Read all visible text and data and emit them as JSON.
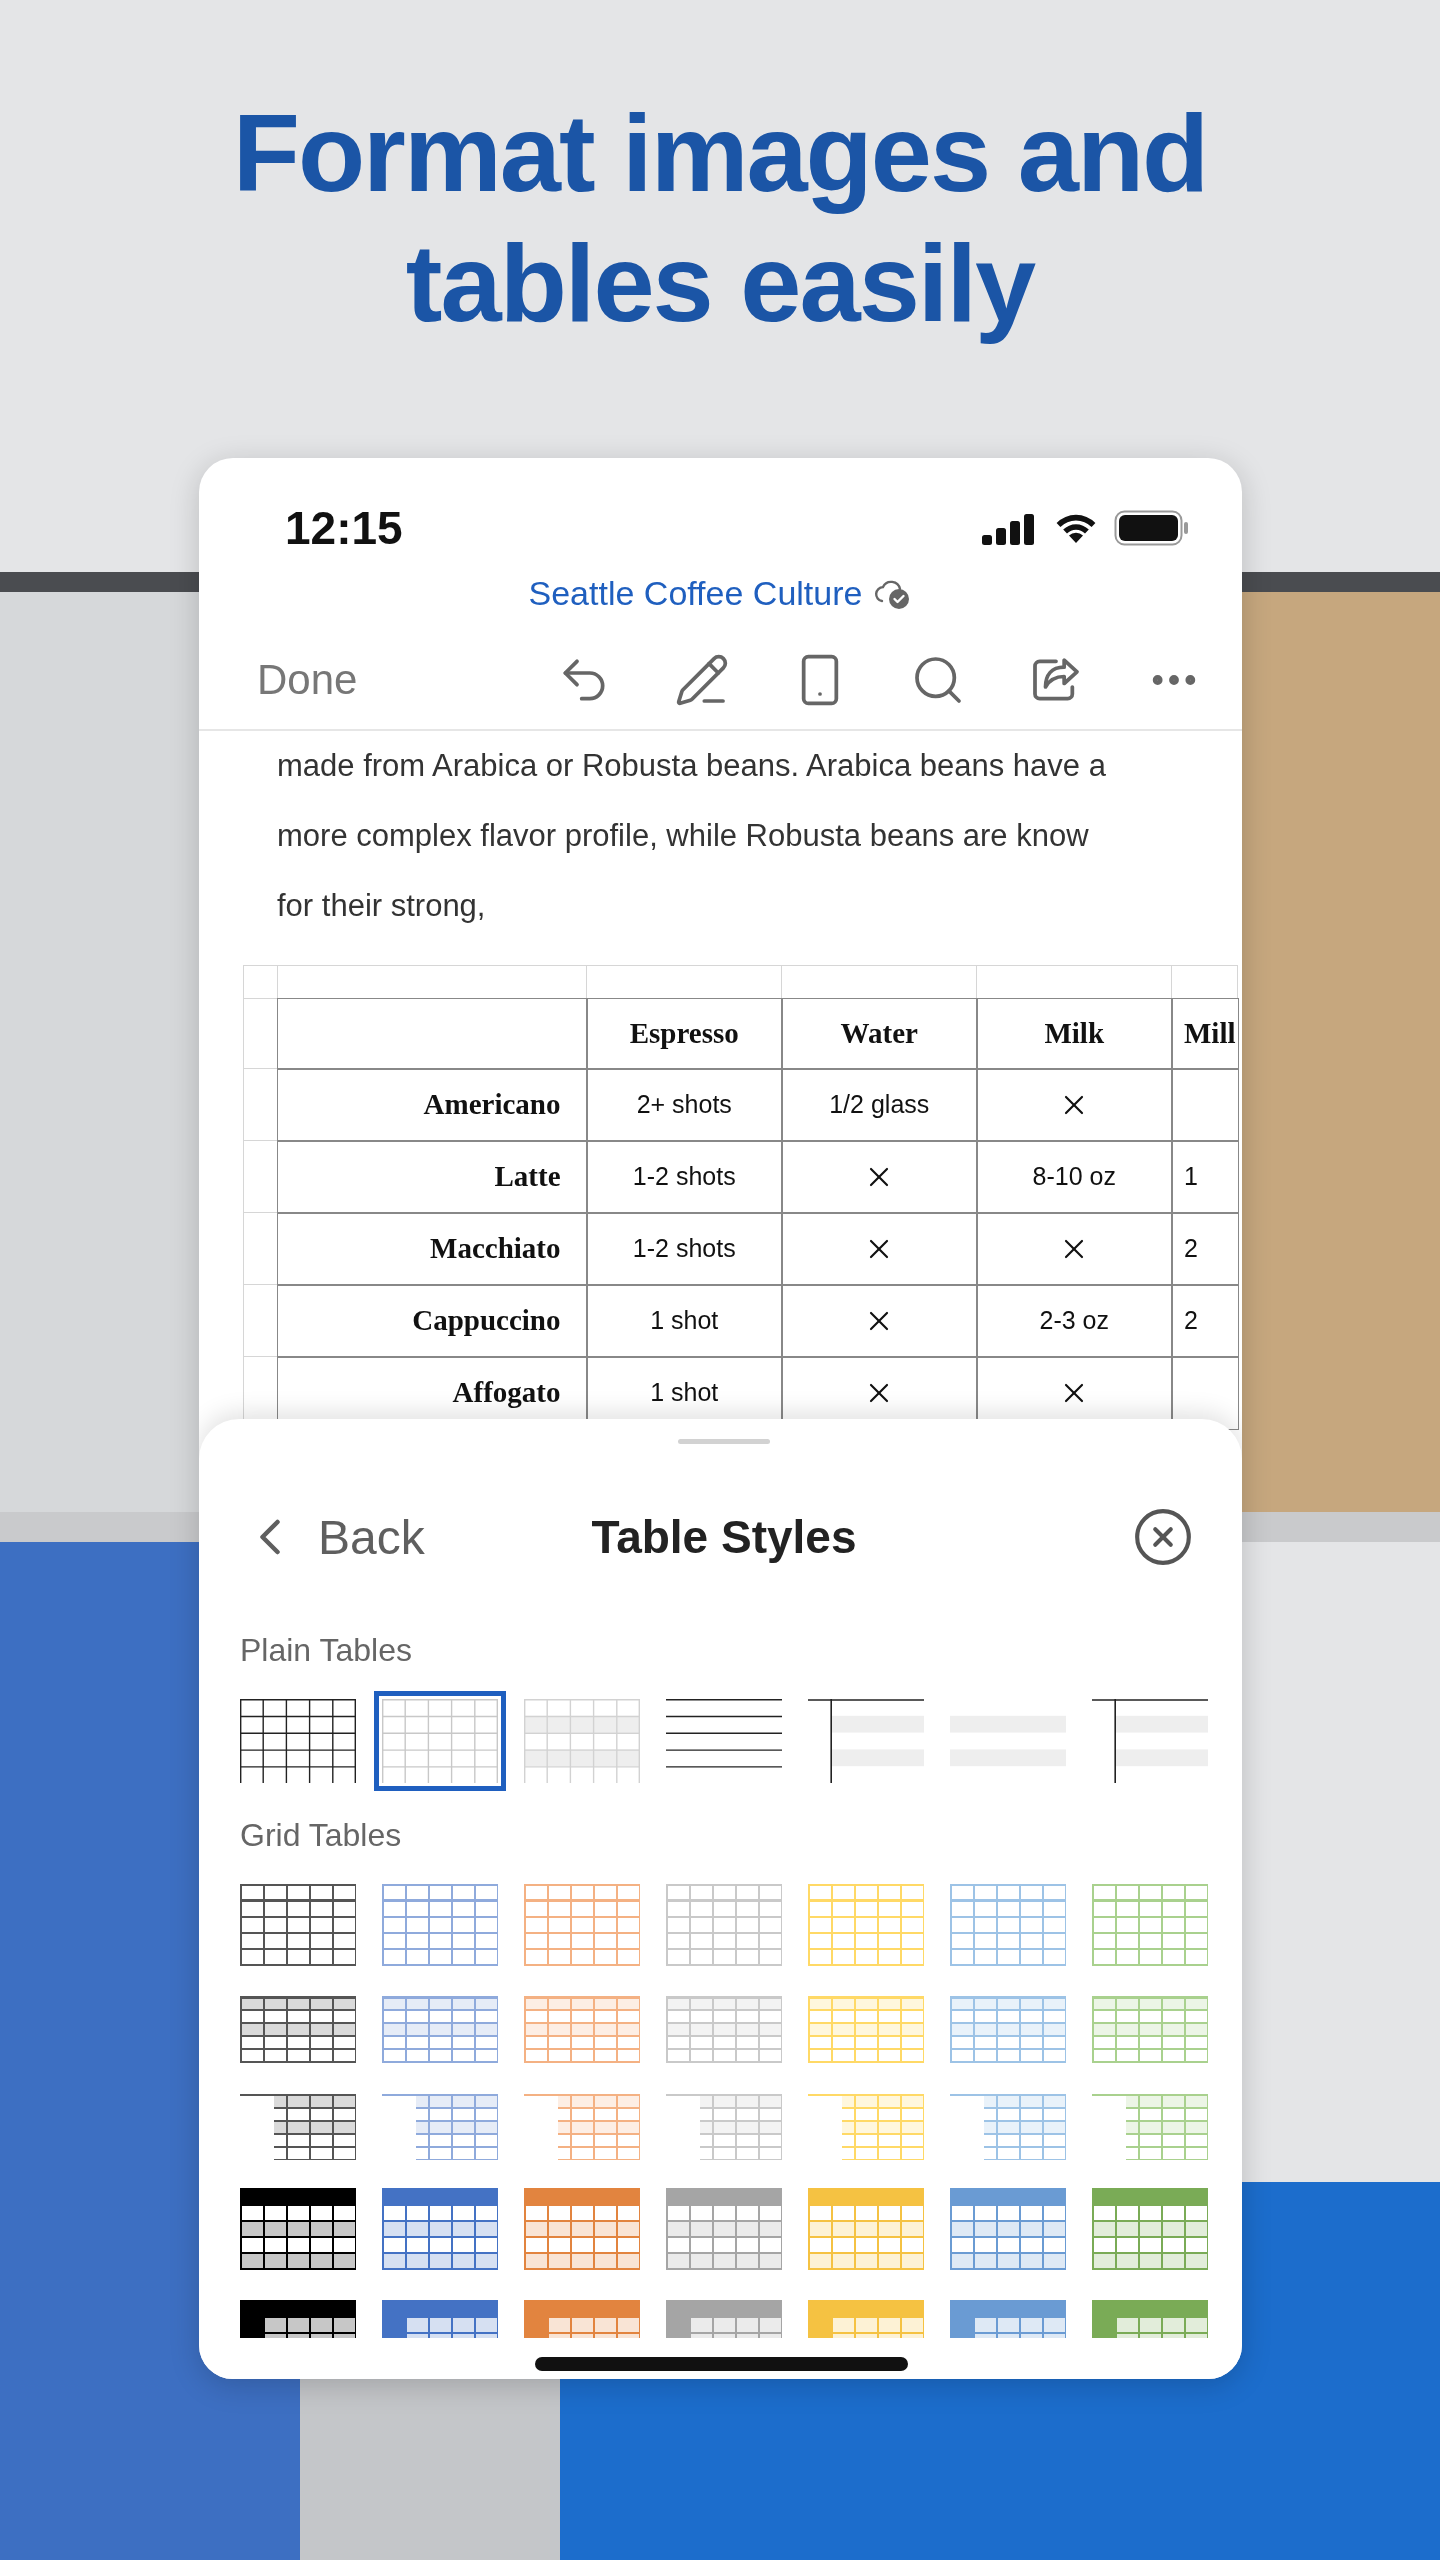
{
  "headline": "Format images and tables easily",
  "status_bar": {
    "time": "12:15"
  },
  "document": {
    "title": "Seattle Coffee Culture",
    "toolbar": {
      "done": "Done"
    },
    "paragraph_lines": [
      "made from Arabica or Robusta beans. Arabica beans have a",
      "more complex flavor profile, while Robusta beans are know",
      "for their strong,"
    ]
  },
  "table": {
    "columns": [
      "Espresso",
      "Water",
      "Milk",
      "Mill"
    ],
    "rows": [
      {
        "name": "Americano",
        "cells": [
          {
            "kind": "text",
            "text": "2+ shots"
          },
          {
            "kind": "text",
            "text": "1/2 glass"
          },
          {
            "kind": "cross"
          }
        ]
      },
      {
        "name": "Latte",
        "cells": [
          {
            "kind": "text",
            "text": "1-2 shots"
          },
          {
            "kind": "cross"
          },
          {
            "kind": "text",
            "text": "8-10 oz"
          },
          {
            "kind": "text",
            "text": "1"
          }
        ]
      },
      {
        "name": "Macchiato",
        "cells": [
          {
            "kind": "text",
            "text": "1-2 shots"
          },
          {
            "kind": "cross"
          },
          {
            "kind": "cross"
          },
          {
            "kind": "text",
            "text": "2"
          }
        ]
      },
      {
        "name": "Cappuccino",
        "cells": [
          {
            "kind": "text",
            "text": "1 shot"
          },
          {
            "kind": "cross"
          },
          {
            "kind": "text",
            "text": "2-3 oz"
          },
          {
            "kind": "text",
            "text": "2"
          }
        ]
      },
      {
        "name": "Affogato",
        "cells": [
          {
            "kind": "text",
            "text": "1 shot"
          },
          {
            "kind": "cross"
          },
          {
            "kind": "cross"
          }
        ]
      }
    ]
  },
  "sheet": {
    "back": "Back",
    "title": "Table Styles",
    "sections": [
      {
        "title": "Plain Tables",
        "rows": [
          {
            "kind": "plain",
            "styles": [
              {
                "kind": "grid",
                "selected": false
              },
              {
                "kind": "light-grid",
                "selected": true
              },
              {
                "kind": "banded",
                "selected": false
              },
              {
                "kind": "lines",
                "selected": false
              },
              {
                "kind": "header-col",
                "selected": false
              },
              {
                "kind": "banded-plain",
                "selected": false
              },
              {
                "kind": "header-col",
                "selected": false
              }
            ]
          }
        ]
      },
      {
        "title": "Grid Tables",
        "rows": [
          {
            "kind": "outline",
            "styles": [
              {
                "color": "#555555",
                "selected": false
              },
              {
                "color": "#8faadc",
                "selected": false
              },
              {
                "color": "#f4b183",
                "selected": false
              },
              {
                "color": "#c9c9c9",
                "selected": false
              },
              {
                "color": "#ffd966",
                "selected": false
              },
              {
                "color": "#9dc3e6",
                "selected": false
              },
              {
                "color": "#a9d18e",
                "selected": false
              }
            ]
          },
          {
            "kind": "banded",
            "styles": [
              {
                "color": "#555555",
                "selected": false
              },
              {
                "color": "#8faadc",
                "selected": false
              },
              {
                "color": "#f4b183",
                "selected": false
              },
              {
                "color": "#c9c9c9",
                "selected": false
              },
              {
                "color": "#ffd966",
                "selected": false
              },
              {
                "color": "#9dc3e6",
                "selected": false
              },
              {
                "color": "#a9d18e",
                "selected": false
              }
            ]
          },
          {
            "kind": "first-col-banded",
            "styles": [
              {
                "color": "#555555",
                "selected": false
              },
              {
                "color": "#8faadc",
                "selected": false
              },
              {
                "color": "#f4b183",
                "selected": false
              },
              {
                "color": "#c9c9c9",
                "selected": false
              },
              {
                "color": "#ffd966",
                "selected": false
              },
              {
                "color": "#9dc3e6",
                "selected": false
              },
              {
                "color": "#a9d18e",
                "selected": false
              }
            ]
          },
          {
            "kind": "header-filled",
            "styles": [
              {
                "color": "#000000",
                "selected": false
              },
              {
                "color": "#4472c4",
                "selected": false
              },
              {
                "color": "#e2843f",
                "selected": false
              },
              {
                "color": "#a5a5a5",
                "selected": false
              },
              {
                "color": "#f5c242",
                "selected": false
              },
              {
                "color": "#6a9bd3",
                "selected": false
              },
              {
                "color": "#7aab56",
                "selected": false
              }
            ]
          },
          {
            "kind": "header-col-filled",
            "styles": [
              {
                "color": "#000000",
                "selected": false
              },
              {
                "color": "#4472c4",
                "selected": false
              },
              {
                "color": "#e2843f",
                "selected": false
              },
              {
                "color": "#a5a5a5",
                "selected": false
              },
              {
                "color": "#f5c242",
                "selected": false
              },
              {
                "color": "#6a9bd3",
                "selected": false
              },
              {
                "color": "#7aab56",
                "selected": false
              }
            ]
          }
        ]
      }
    ]
  }
}
